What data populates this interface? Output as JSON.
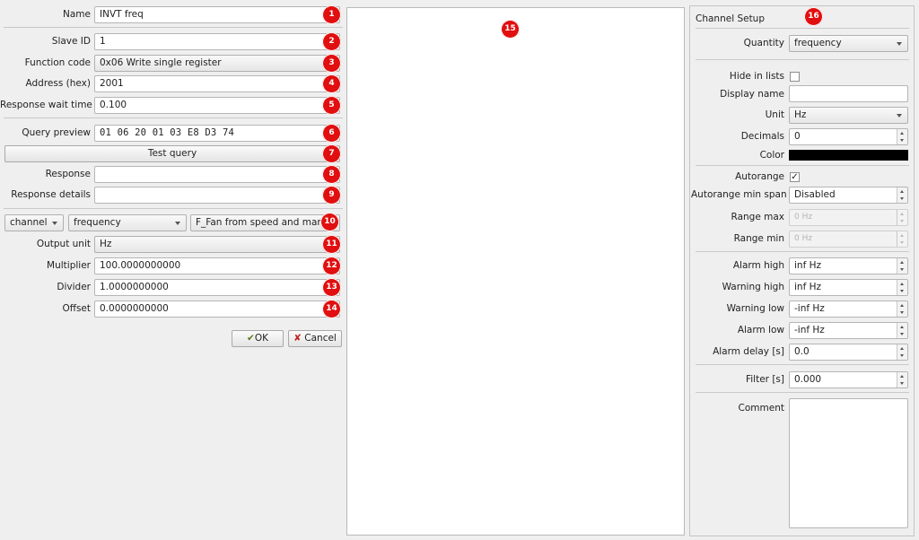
{
  "form": {
    "name_label": "Name",
    "name_value": "INVT freq",
    "slave_label": "Slave ID",
    "slave_value": "1",
    "function_label": "Function code",
    "function_value": "0x06 Write single register",
    "address_label": "Address (hex)",
    "address_value": "2001",
    "wait_label": "Response wait time",
    "wait_value": "0.100",
    "query_label": "Query preview",
    "query_value": "01  06  20  01  03  E8  D3  74",
    "test_button": "Test query",
    "response_label": "Response",
    "response_value": "",
    "details_label": "Response details",
    "details_value": "",
    "type_combo": "channel",
    "quantity_combo": "frequency",
    "channel_value": "F_Fan from speed and manual",
    "unit_label": "Output unit",
    "unit_value": "Hz",
    "multiplier_label": "Multiplier",
    "multiplier_value": "100.0000000000",
    "divider_label": "Divider",
    "divider_value": "1.0000000000",
    "offset_label": "Offset",
    "offset_value": "0.0000000000",
    "ok_button": "OK",
    "cancel_button": "Cancel"
  },
  "badges": [
    "1",
    "2",
    "3",
    "4",
    "5",
    "6",
    "7",
    "8",
    "9",
    "10",
    "11",
    "12",
    "13",
    "14",
    "15",
    "16"
  ],
  "channel_setup": {
    "title": "Channel Setup",
    "quantity_label": "Quantity",
    "quantity_value": "frequency",
    "hide_label": "Hide in lists",
    "display_label": "Display name",
    "display_value": "",
    "unit_label": "Unit",
    "unit_value": "Hz",
    "decimals_label": "Decimals",
    "decimals_value": "0",
    "color_label": "Color",
    "color_value": "#000000",
    "autorange_label": "Autorange",
    "autorange_checked": "✓",
    "minspan_label": "Autorange min span",
    "minspan_value": "Disabled",
    "rangemax_label": "Range max",
    "rangemax_value": "0 Hz",
    "rangemin_label": "Range min",
    "rangemin_value": "0 Hz",
    "alarmhigh_label": "Alarm high",
    "alarmhigh_value": "inf Hz",
    "warnhigh_label": "Warning high",
    "warnhigh_value": "inf Hz",
    "warnlow_label": "Warning low",
    "warnlow_value": "-inf Hz",
    "alarmlow_label": "Alarm low",
    "alarmlow_value": "-inf Hz",
    "alarmdelay_label": "Alarm delay [s]",
    "alarmdelay_value": "0.0",
    "filter_label": "Filter [s]",
    "filter_value": "0.000",
    "comment_label": "Comment",
    "comment_value": ""
  },
  "colors": {
    "badge": "#e10f0f"
  }
}
